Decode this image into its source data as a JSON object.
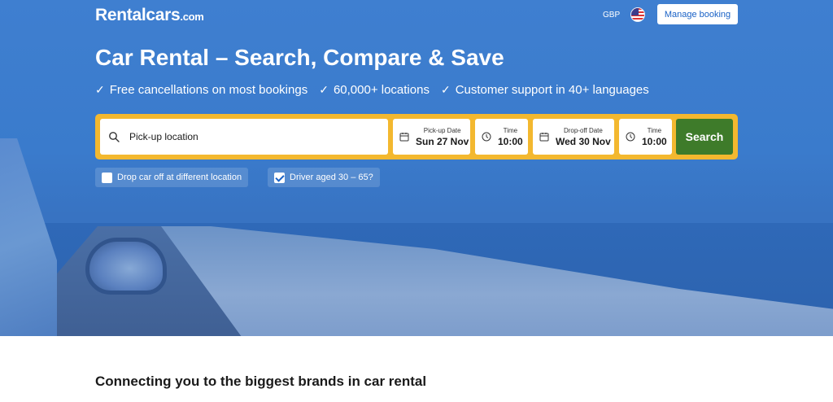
{
  "header": {
    "logo_main": "Rentalcars",
    "logo_suffix": ".com",
    "currency": "GBP",
    "flag_icon": "us-flag-icon",
    "manage_booking": "Manage booking"
  },
  "hero": {
    "headline": "Car Rental – Search, Compare & Save",
    "benefits": [
      "Free cancellations on most bookings",
      "60,000+ locations",
      "Customer support in 40+ languages"
    ]
  },
  "search": {
    "pickup_location_placeholder": "Pick-up location",
    "pickup_date_label": "Pick-up Date",
    "pickup_date_value": "Sun 27 Nov",
    "pickup_time_label": "Time",
    "pickup_time_value": "10:00",
    "dropoff_date_label": "Drop-off Date",
    "dropoff_date_value": "Wed 30 Nov",
    "dropoff_time_label": "Time",
    "dropoff_time_value": "10:00",
    "search_button": "Search"
  },
  "options": {
    "drop_different_label": "Drop car off at different location",
    "drop_different_checked": false,
    "driver_age_label": "Driver aged 30 – 65?",
    "driver_age_checked": true
  },
  "content": {
    "section_title": "Connecting you to the biggest brands in car rental"
  },
  "colors": {
    "hero_blue": "#3a7bcc",
    "search_border": "#f3b82f",
    "search_button": "#3e7b2a",
    "link_blue": "#1a62c6"
  }
}
